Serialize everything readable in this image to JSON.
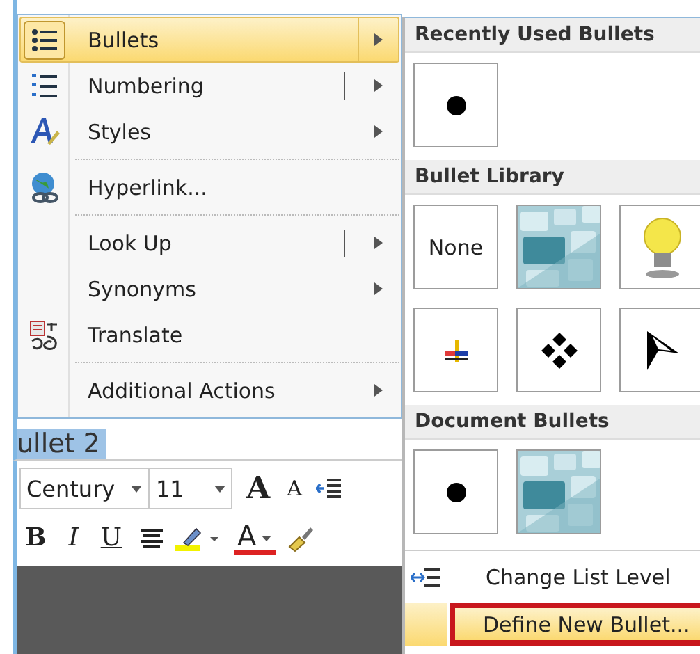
{
  "document": {
    "text": "ullet 2"
  },
  "mini_toolbar": {
    "font": "Century",
    "size": "11",
    "row1": [
      {
        "kind": "grow",
        "label": "A"
      },
      {
        "kind": "shrink",
        "label": "A"
      },
      {
        "kind": "outdent"
      }
    ],
    "row2": [
      {
        "kind": "bold",
        "label": "B"
      },
      {
        "kind": "italic",
        "label": "I"
      },
      {
        "kind": "underline",
        "label": "U"
      },
      {
        "kind": "center"
      },
      {
        "kind": "highlight"
      },
      {
        "kind": "fontcolor",
        "label": "A"
      },
      {
        "kind": "painter"
      }
    ]
  },
  "context_menu": {
    "items": [
      {
        "kind": "bullets",
        "label": "Bullets",
        "submenu": true,
        "split": false,
        "selected": true,
        "separator_after": false
      },
      {
        "kind": "numbering",
        "label": "Numbering",
        "submenu": true,
        "split": true,
        "selected": false,
        "separator_after": false
      },
      {
        "kind": "styles",
        "label": "Styles",
        "submenu": true,
        "split": false,
        "selected": false,
        "separator_after": true
      },
      {
        "kind": "hyperlink",
        "label": "Hyperlink...",
        "submenu": false,
        "split": false,
        "selected": false,
        "separator_after": true
      },
      {
        "kind": "plain",
        "label": "Look Up",
        "submenu": true,
        "split": true,
        "selected": false,
        "separator_after": false
      },
      {
        "kind": "plain",
        "label": "Synonyms",
        "submenu": true,
        "split": false,
        "selected": false,
        "separator_after": false
      },
      {
        "kind": "translate",
        "label": "Translate",
        "submenu": false,
        "split": false,
        "selected": false,
        "separator_after": true
      },
      {
        "kind": "plain",
        "label": "Additional Actions",
        "submenu": true,
        "split": false,
        "selected": false,
        "separator_after": false
      }
    ]
  },
  "bullets_menu": {
    "sections": [
      {
        "title": "Recently Used Bullets",
        "tiles": [
          {
            "kind": "dot"
          }
        ]
      },
      {
        "title": "Bullet Library",
        "tiles": [
          {
            "kind": "none",
            "label": "None"
          },
          {
            "kind": "picture"
          },
          {
            "kind": "lightbulb"
          },
          {
            "kind": "cross"
          },
          {
            "kind": "diamonds"
          },
          {
            "kind": "arrowhead"
          }
        ]
      },
      {
        "title": "Document Bullets",
        "tiles": [
          {
            "kind": "dot"
          },
          {
            "kind": "picture"
          }
        ]
      }
    ],
    "commands": [
      {
        "kind": "list-level",
        "label": "Change List Level",
        "selected": false,
        "outlined": false
      },
      {
        "kind": "plain",
        "label": "Define New Bullet...",
        "selected": true,
        "outlined": true
      }
    ]
  }
}
